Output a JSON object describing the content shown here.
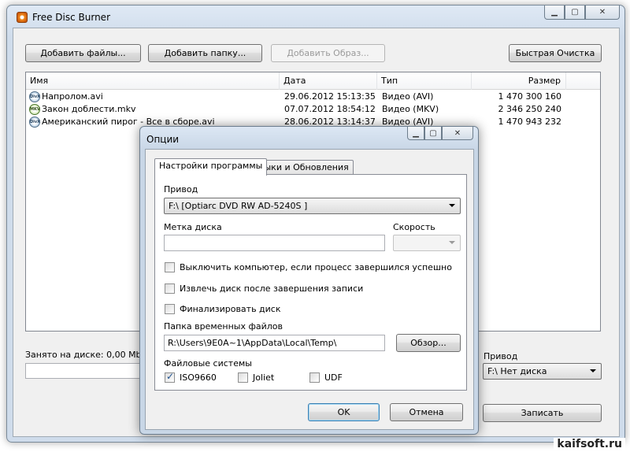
{
  "app": {
    "title": "Free Disc Burner"
  },
  "toolbar": {
    "add_files": "Добавить файлы...",
    "add_folder": "Добавить папку...",
    "add_image": "Добавить Образ...",
    "quick_clear": "Быстрая Очистка"
  },
  "filelist": {
    "columns": [
      "Имя",
      "Дата",
      "Тип",
      "Размер"
    ],
    "rows": [
      {
        "icon": "divx-file-icon",
        "name": "Напролом.avi",
        "date": "29.06.2012 15:13:35",
        "type": "Видео (AVI)",
        "size": "1 470 300 160"
      },
      {
        "icon": "mkv-file-icon",
        "name": "Закон доблести.mkv",
        "date": "07.07.2012 18:54:12",
        "type": "Видео (MKV)",
        "size": "2 346 250 240"
      },
      {
        "icon": "divx-file-icon",
        "name": "Американский пирог - Все в сборе.avi",
        "date": "28.06.2012 13:14:37",
        "type": "Видео (AVI)",
        "size": "1 470 943 232"
      }
    ]
  },
  "status": {
    "used": "Занято на диске: 0,00 Mb",
    "drive_label": "Привод",
    "drive_value": "F:\\ Нет диска",
    "burn": "Записать"
  },
  "dialog": {
    "title": "Опции",
    "tabs": [
      "Настройки программы",
      "Языки и Обновления"
    ],
    "drive_label": "Привод",
    "drive_value": "F:\\ [Optiarc DVD RW AD-5240S ]",
    "disc_label": "Метка диска",
    "disc_label_value": "",
    "speed_label": "Скорость",
    "speed_value": "",
    "checkboxes": [
      {
        "label": "Выключить компьютер, если процесс завершился успешно",
        "checked": false
      },
      {
        "label": "Извлечь диск после завершения записи",
        "checked": false
      },
      {
        "label": "Финализировать диск",
        "checked": false
      }
    ],
    "temp_folder_label": "Папка временных файлов",
    "temp_folder_value": "R:\\Users\\9E0A~1\\AppData\\Local\\Temp\\",
    "browse": "Обзор...",
    "fs_label": "Файловые системы",
    "fs": [
      {
        "label": "ISO9660",
        "checked": true
      },
      {
        "label": "Joliet",
        "checked": false
      },
      {
        "label": "UDF",
        "checked": false
      }
    ],
    "ok": "OK",
    "cancel": "Отмена"
  },
  "watermark": "kaifsoft.ru"
}
